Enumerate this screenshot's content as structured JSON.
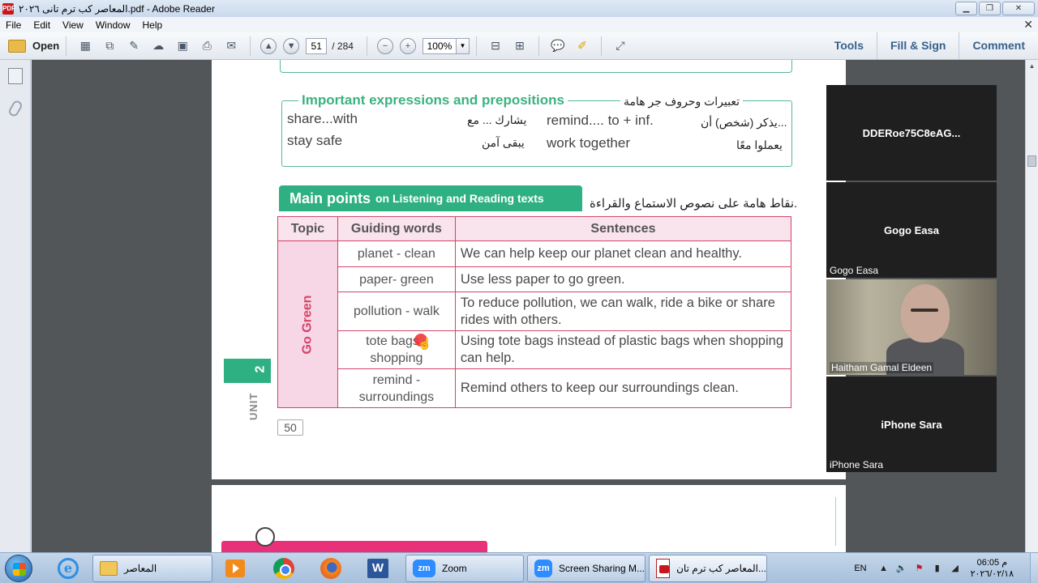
{
  "window": {
    "title": "المعاصر كب ترم تانى ٢٠٢٦.pdf - Adobe Reader",
    "app_icon_text": "PDF",
    "buttons": {
      "minimize": "▁",
      "maximize": "❐",
      "close": "✕"
    }
  },
  "menu": {
    "items": [
      "File",
      "Edit",
      "View",
      "Window",
      "Help"
    ],
    "close_glyph": "✕"
  },
  "toolbar": {
    "open_label": "Open",
    "page_current": "51",
    "page_total": "/ 284",
    "zoom": "100%",
    "right_items": [
      "Tools",
      "Fill & Sign",
      "Comment"
    ]
  },
  "document": {
    "expressions": {
      "title_en": "Important expressions and prepositions",
      "title_ar": "تعبيرات وحروف جر هامة",
      "rows": [
        {
          "en1": "share...with",
          "ar1": "يشارك ... مع",
          "en2": "remind.... to + inf.",
          "ar2": "يذكر (شخص) أن..."
        },
        {
          "en1": "stay safe",
          "ar1": "يبقى آمن",
          "en2": "work together",
          "ar2": "يعملوا معًا"
        }
      ]
    },
    "main_points": {
      "banner_bold": "Main points",
      "banner_rest": "on Listening and Reading texts",
      "arabic": "نقاط هامة على نصوص الاستماع والقراءة.",
      "headers": {
        "topic": "Topic",
        "guiding": "Guiding words",
        "sentences": "Sentences"
      },
      "topic_value": "Go Green",
      "rows": [
        {
          "guiding": "planet - clean",
          "sentence": "We can help keep our planet clean and healthy."
        },
        {
          "guiding": "paper- green",
          "sentence": "Use less paper to go green."
        },
        {
          "guiding": "pollution - walk",
          "sentence": "To reduce pollution, we can walk, ride a bike or share rides with others."
        },
        {
          "guiding": "tote bags - shopping",
          "sentence": "Using tote bags instead of plastic bags when shopping can help."
        },
        {
          "guiding": "remind - surroundings",
          "sentence": "Remind others to keep our surroundings clean."
        }
      ]
    },
    "unit_number": "2",
    "unit_label": "UNIT",
    "page_number": "50"
  },
  "zoom_participants": [
    {
      "center": "DDERoe75C8eAG...",
      "label": ""
    },
    {
      "center": "Gogo Easa",
      "label": "Gogo Easa"
    },
    {
      "center": "",
      "label": "Haitham Gamal Eldeen"
    },
    {
      "center": "iPhone Sara",
      "label": "iPhone Sara"
    }
  ],
  "taskbar": {
    "tasks": [
      {
        "label": "المعاصر"
      },
      {
        "label": "Zoom"
      },
      {
        "label": "Screen Sharing M..."
      },
      {
        "label": "المعاصر كب ترم تان..."
      }
    ],
    "lang": "EN",
    "time": "06:05 م",
    "date": "٢٠٢٦/٠٢/١٨"
  },
  "colors": {
    "accent_green": "#2fb083",
    "table_border": "#d54468",
    "topic_fill": "#f7d6e6",
    "zoom_tile": "#1f1f1f"
  }
}
